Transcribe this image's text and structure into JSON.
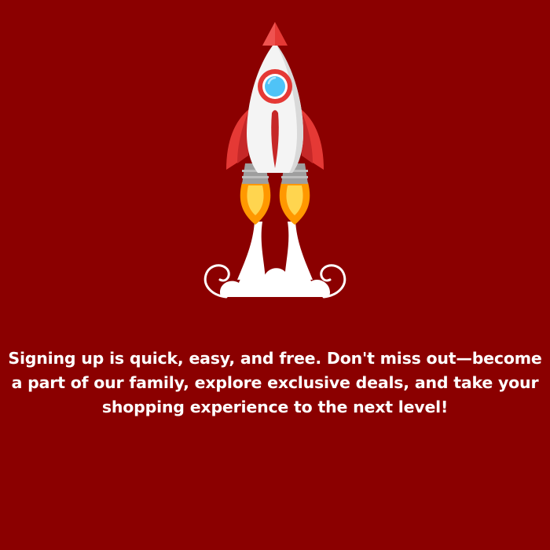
{
  "page": {
    "background_color": "#8b0000",
    "message": "Signing up is quick, easy, and free. Don't miss out—become a part of our family, explore exclusive deals, and take your shopping experience to the next level!"
  },
  "illustration": {
    "name": "rocket-launch-icon",
    "colors": {
      "body": "#f4f4f4",
      "shade": "#d9d9d9",
      "nose_and_fins": "#e53935",
      "fin_dark": "#c62828",
      "window_ring": "#e53935",
      "window_glass": "#4fc3f7",
      "nozzle": "#9e9e9e",
      "flame_outer": "#ff9800",
      "flame_inner": "#ffd54f",
      "smoke": "#ffffff"
    }
  }
}
